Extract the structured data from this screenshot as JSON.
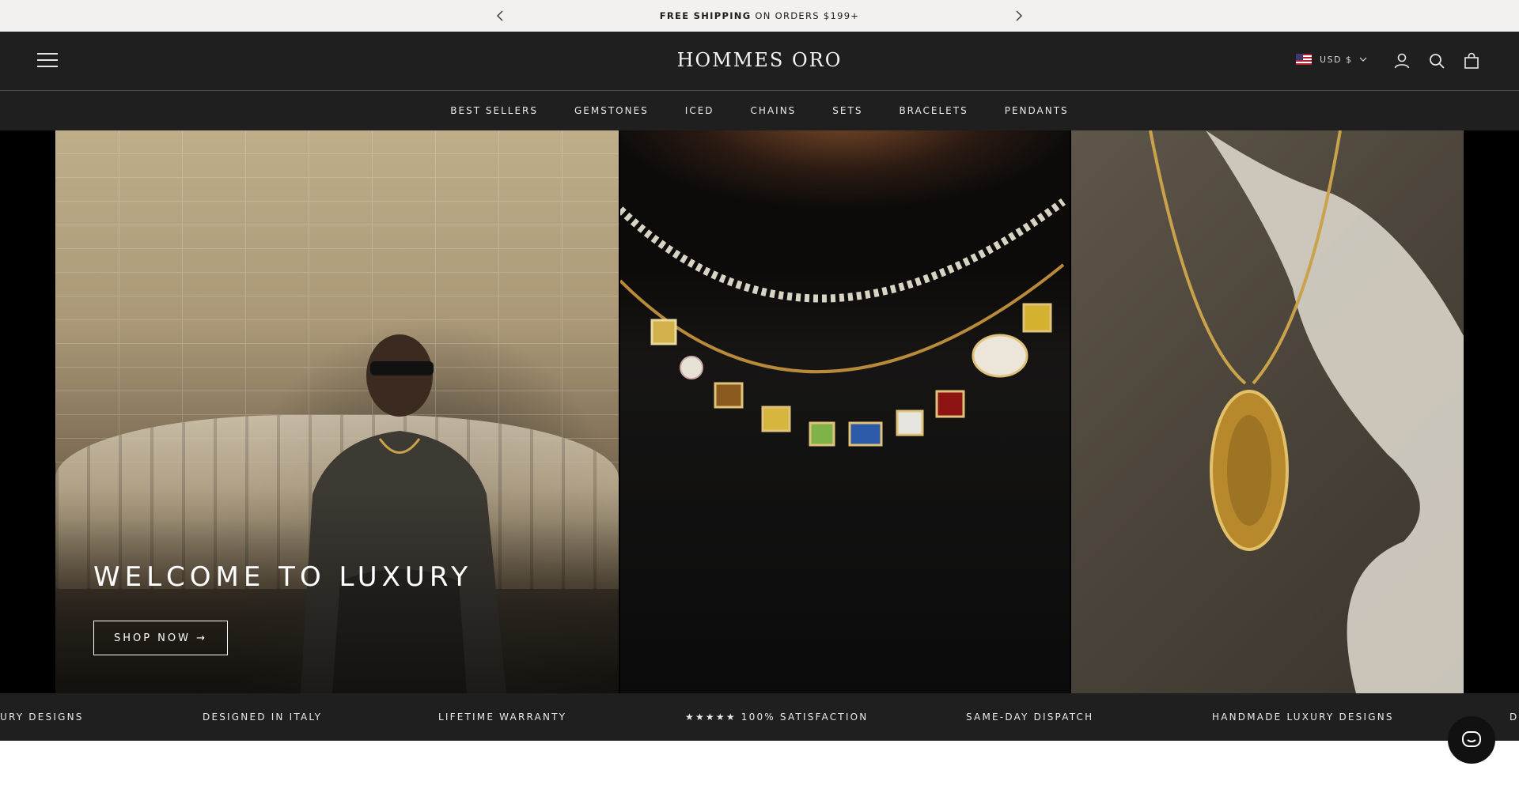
{
  "announcement": {
    "bold": "FREE SHIPPING",
    "rest": " ON ORDERS $199+"
  },
  "header": {
    "logo": "HOMMES ORO",
    "currency": "USD $"
  },
  "nav": [
    "BEST SELLERS",
    "GEMSTONES",
    "ICED",
    "CHAINS",
    "SETS",
    "BRACELETS",
    "PENDANTS"
  ],
  "hero": {
    "title": "WELCOME TO LUXURY",
    "button": "SHOP NOW →"
  },
  "marquee": [
    "URY DESIGNS",
    "DESIGNED IN ITALY",
    "LIFETIME WARRANTY",
    "★★★★★ 100% SATISFACTION",
    "SAME-DAY DISPATCH",
    "HANDMADE LUXURY DESIGNS",
    "D"
  ],
  "colors": {
    "header_bg": "#1f1f1f",
    "announcement_bg": "#f2f1ef",
    "gold": "#c9a24a"
  },
  "icons": [
    "chevron-left-icon",
    "chevron-right-icon",
    "menu-icon",
    "us-flag-icon",
    "chevron-down-icon",
    "account-icon",
    "search-icon",
    "bag-icon",
    "chat-icon"
  ]
}
